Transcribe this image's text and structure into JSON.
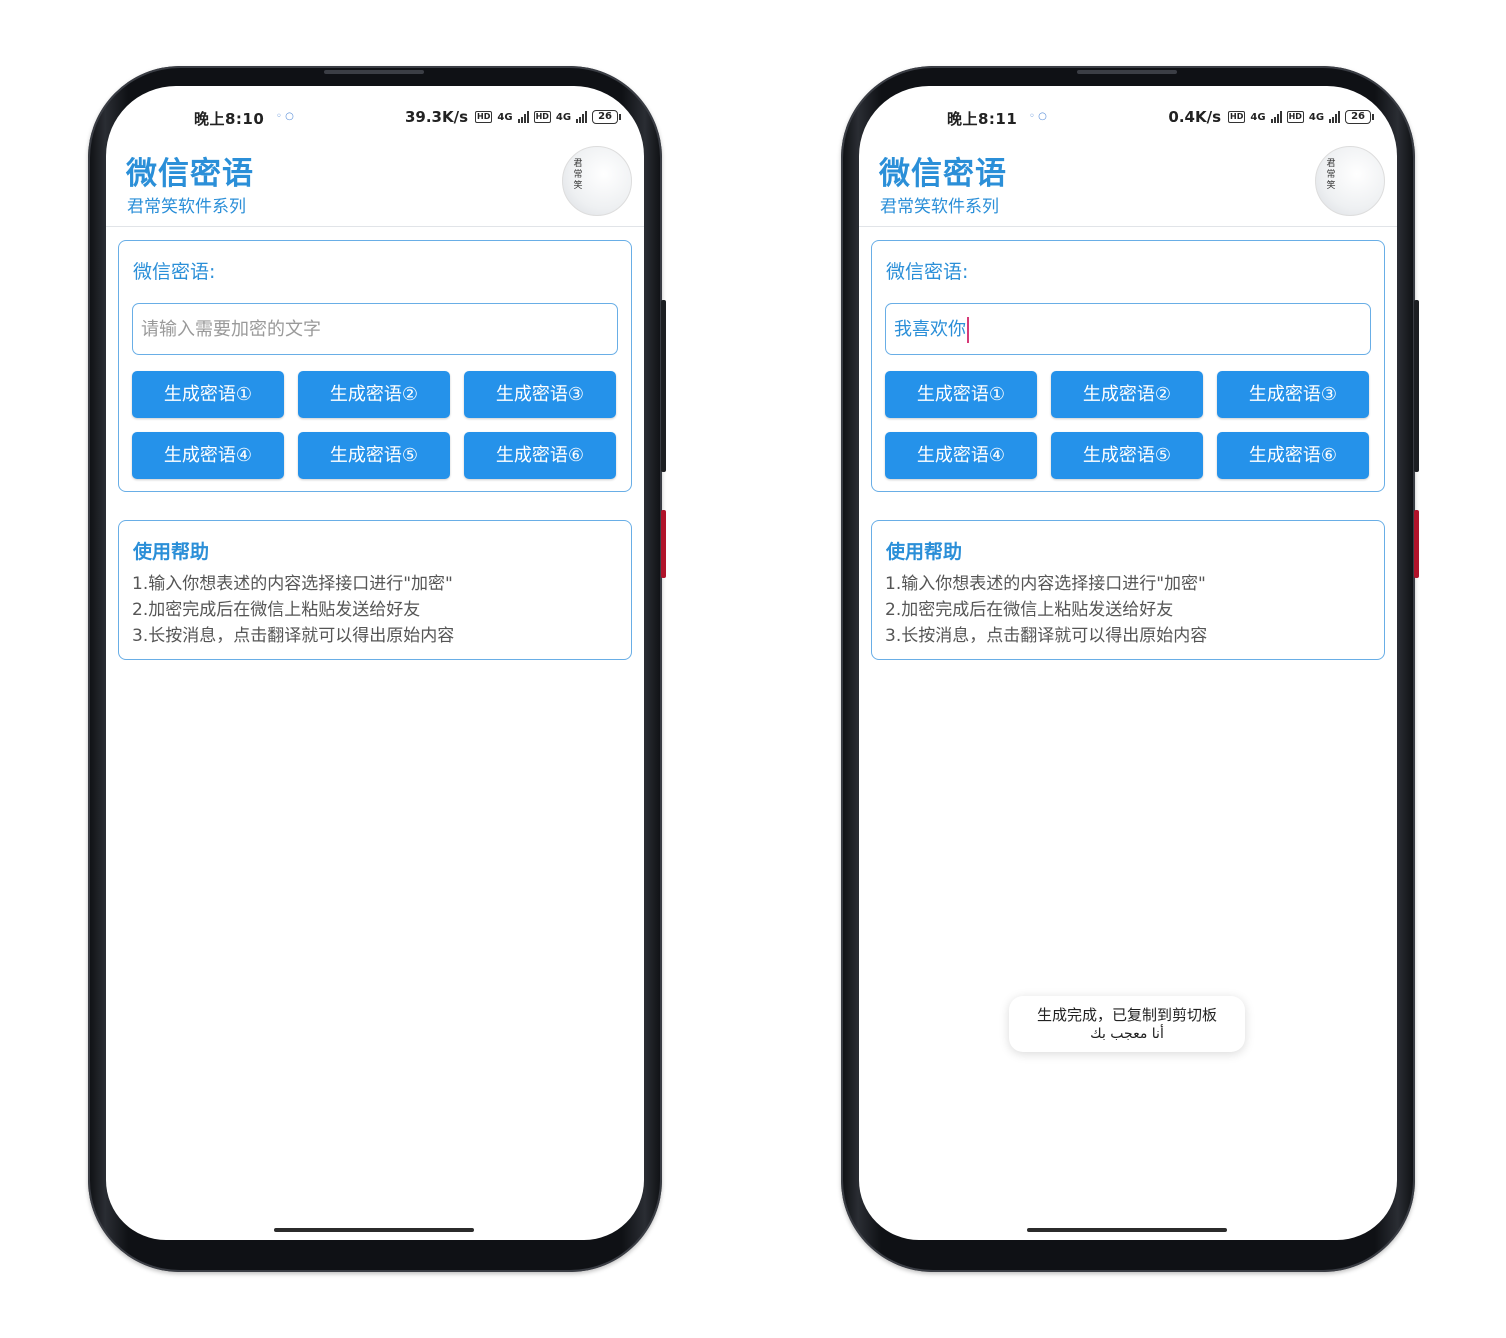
{
  "app": {
    "title": "微信密语",
    "subtitle": "君常笑软件系列",
    "avatar_seal": "君常笑"
  },
  "encrypt_card": {
    "label": "微信密语:",
    "input_placeholder": "请输入需要加密的文字",
    "buttons": [
      "生成密语①",
      "生成密语②",
      "生成密语③",
      "生成密语④",
      "生成密语⑤",
      "生成密语⑥"
    ]
  },
  "help": {
    "title": "使用帮助",
    "lines": [
      "1.输入你想表述的内容选择接口进行\"加密\"",
      "2.加密完成后在微信上粘贴发送给好友",
      "3.长按消息，点击翻译就可以得出原始内容"
    ]
  },
  "screens": [
    {
      "status": {
        "time": "晚上8:10",
        "rate": "39.3K/s",
        "network": "4G",
        "battery": "26"
      },
      "input_value": ""
    },
    {
      "status": {
        "time": "晚上8:11",
        "rate": "0.4K/s",
        "network": "4G",
        "battery": "26"
      },
      "input_value": "我喜欢你",
      "toast": {
        "line1": "生成完成，已复制到剪切板",
        "line2": "أنا معجب بك"
      }
    }
  ],
  "colors": {
    "accent": "#2b8fd8",
    "button": "#2592ea",
    "border": "#69aee6",
    "caret": "#d63a78"
  }
}
